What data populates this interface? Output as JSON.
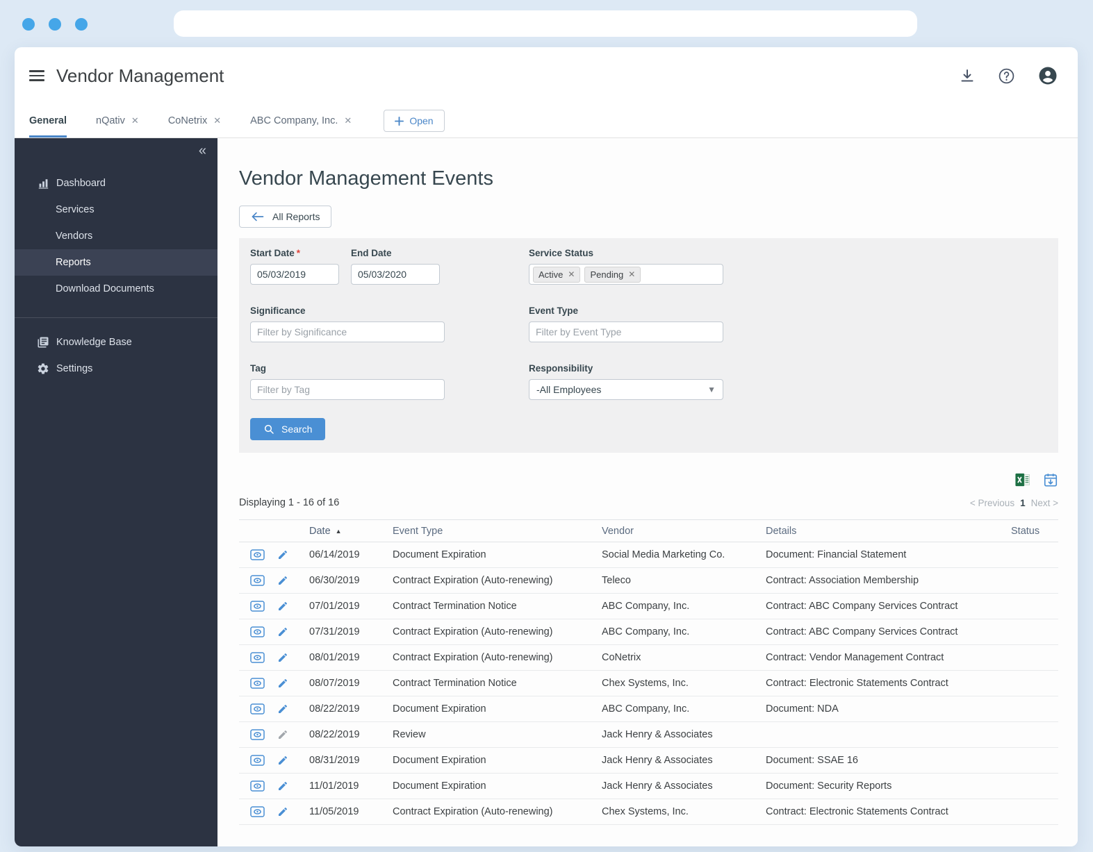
{
  "colors": {
    "accent_blue": "#4a86c8",
    "search_button_blue": "#4a8fd4",
    "sidebar_bg": "#2c3342",
    "sidebar_active_bg": "#3b4254",
    "excel_green": "#1d7044",
    "required_asterisk_red": "#e0443a",
    "chrome_bg": "#dde9f5",
    "browser_dot_blue": "#45a6e8"
  },
  "header": {
    "title": "Vendor Management"
  },
  "tabs": {
    "items": [
      {
        "label": "General"
      },
      {
        "label": "nQativ"
      },
      {
        "label": "CoNetrix"
      },
      {
        "label": "ABC Company, Inc."
      }
    ],
    "open_button_label": "Open"
  },
  "sidebar": {
    "items": [
      {
        "label": "Dashboard"
      },
      {
        "label": "Services"
      },
      {
        "label": "Vendors"
      },
      {
        "label": "Reports"
      },
      {
        "label": "Download Documents"
      }
    ],
    "secondary_items": [
      {
        "label": "Knowledge Base"
      },
      {
        "label": "Settings"
      }
    ]
  },
  "main": {
    "page_title": "Vendor Management Events",
    "all_reports_label": "All Reports",
    "filters": {
      "start_date": {
        "label": "Start Date",
        "required_mark": "*",
        "value": "05/03/2019"
      },
      "end_date": {
        "label": "End Date",
        "value": "05/03/2020"
      },
      "service_status": {
        "label": "Service Status",
        "chips": [
          "Active",
          "Pending"
        ]
      },
      "significance": {
        "label": "Significance",
        "placeholder": "Filter by Significance"
      },
      "event_type": {
        "label": "Event Type",
        "placeholder": "Filter by Event Type"
      },
      "tag": {
        "label": "Tag",
        "placeholder": "Filter by Tag"
      },
      "responsibility": {
        "label": "Responsibility",
        "value": "-All Employees"
      },
      "search_label": "Search"
    },
    "results_summary": "Displaying 1 - 16 of 16",
    "pagination": {
      "previous": "< Previous",
      "page": "1",
      "next": "Next >"
    },
    "table": {
      "columns": {
        "date": "Date",
        "event_type": "Event Type",
        "vendor": "Vendor",
        "details": "Details",
        "status": "Status"
      },
      "rows": [
        {
          "date": "06/14/2019",
          "event_type": "Document Expiration",
          "vendor": "Social Media Marketing Co.",
          "details": "Document: Financial Statement",
          "status": "",
          "edit_enabled": true
        },
        {
          "date": "06/30/2019",
          "event_type": "Contract Expiration (Auto-renewing)",
          "vendor": "Teleco",
          "details": "Contract: Association Membership",
          "status": "",
          "edit_enabled": true
        },
        {
          "date": "07/01/2019",
          "event_type": "Contract Termination Notice",
          "vendor": "ABC Company, Inc.",
          "details": "Contract: ABC Company Services Contract",
          "status": "",
          "edit_enabled": true
        },
        {
          "date": "07/31/2019",
          "event_type": "Contract Expiration (Auto-renewing)",
          "vendor": "ABC Company, Inc.",
          "details": "Contract: ABC Company Services Contract",
          "status": "",
          "edit_enabled": true
        },
        {
          "date": "08/01/2019",
          "event_type": "Contract Expiration (Auto-renewing)",
          "vendor": "CoNetrix",
          "details": "Contract: Vendor Management Contract",
          "status": "",
          "edit_enabled": true
        },
        {
          "date": "08/07/2019",
          "event_type": "Contract Termination Notice",
          "vendor": "Chex Systems, Inc.",
          "details": "Contract: Electronic Statements Contract",
          "status": "",
          "edit_enabled": true
        },
        {
          "date": "08/22/2019",
          "event_type": "Document Expiration",
          "vendor": "ABC Company, Inc.",
          "details": "Document: NDA",
          "status": "",
          "edit_enabled": true
        },
        {
          "date": "08/22/2019",
          "event_type": "Review",
          "vendor": "Jack Henry & Associates",
          "details": "",
          "status": "",
          "edit_enabled": false
        },
        {
          "date": "08/31/2019",
          "event_type": "Document Expiration",
          "vendor": "Jack Henry & Associates",
          "details": "Document: SSAE 16",
          "status": "",
          "edit_enabled": true
        },
        {
          "date": "11/01/2019",
          "event_type": "Document Expiration",
          "vendor": "Jack Henry & Associates",
          "details": "Document: Security Reports",
          "status": "",
          "edit_enabled": true
        },
        {
          "date": "11/05/2019",
          "event_type": "Contract Expiration (Auto-renewing)",
          "vendor": "Chex Systems, Inc.",
          "details": "Contract: Electronic Statements Contract",
          "status": "",
          "edit_enabled": true
        }
      ]
    }
  }
}
